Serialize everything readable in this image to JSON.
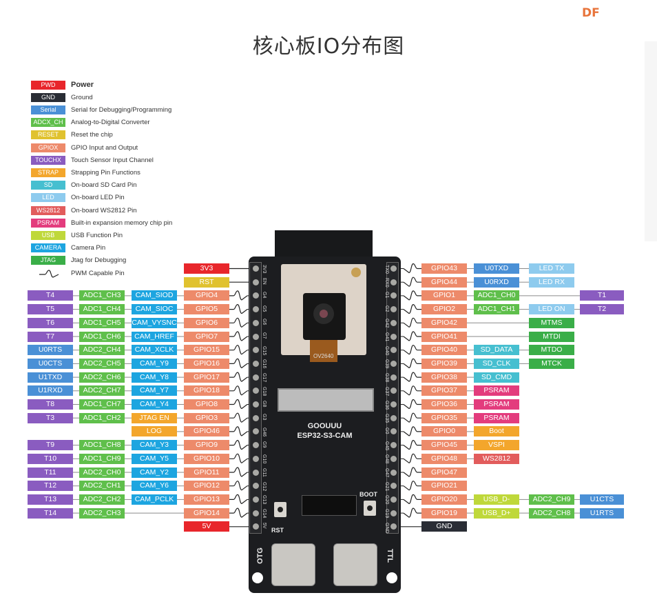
{
  "logo": "DF",
  "title": "核心板IO分布图",
  "colors": {
    "power": "#e8262b",
    "ground": "#2a2d35",
    "serial": "#4a90d6",
    "adc": "#5fbf4b",
    "reset": "#e0c22f",
    "gpio": "#ed8a6a",
    "touch": "#8a5cc0",
    "strap": "#f3a62c",
    "sd": "#46bfd0",
    "led": "#8ecbee",
    "ws2812": "#e25c5c",
    "psram": "#e33c7d",
    "usb": "#bfd83a",
    "camera": "#1da5e0",
    "jtag": "#3aae48",
    "line": "#8a8a8a"
  },
  "legend": [
    {
      "tag": "PWD",
      "type": "power",
      "desc": "Power"
    },
    {
      "tag": "GND",
      "type": "ground",
      "desc": "Ground"
    },
    {
      "tag": "Serial",
      "type": "serial",
      "desc": "Serial for Debugging/Programming"
    },
    {
      "tag": "ADCX_CH",
      "type": "adc",
      "desc": "Analog-to-Digital Converter"
    },
    {
      "tag": "RESET",
      "type": "reset",
      "desc": "Reset the chip"
    },
    {
      "tag": "GPIOX",
      "type": "gpio",
      "desc": "GPIO Input and Output"
    },
    {
      "tag": "TOUCHX",
      "type": "touch",
      "desc": "Touch Sensor Input Channel"
    },
    {
      "tag": "STRAP",
      "type": "strap",
      "desc": "Strapping Pin Functions"
    },
    {
      "tag": "SD",
      "type": "sd",
      "desc": "On-board SD Card Pin"
    },
    {
      "tag": "LED",
      "type": "led",
      "desc": "On-board LED Pin"
    },
    {
      "tag": "WS2812",
      "type": "ws2812",
      "desc": "On-board WS2812 Pin"
    },
    {
      "tag": "PSRAM",
      "type": "psram",
      "desc": "Built-in expansion memory chip pin"
    },
    {
      "tag": "USB",
      "type": "usb",
      "desc": "USB Function Pin"
    },
    {
      "tag": "CAMERA",
      "type": "camera",
      "desc": "Camera Pin"
    },
    {
      "tag": "JTAG",
      "type": "jtag",
      "desc": "Jtag for Debugging"
    },
    {
      "tag": "",
      "type": "pwm",
      "desc": "PWM Capable Pin"
    }
  ],
  "left_pins": [
    {
      "silk": "3V3",
      "pwm": false,
      "labels": [
        null,
        null,
        null,
        {
          "t": "3V3",
          "c": "power"
        }
      ]
    },
    {
      "silk": "EN",
      "pwm": false,
      "labels": [
        null,
        null,
        null,
        {
          "t": "RST",
          "c": "reset"
        }
      ]
    },
    {
      "silk": "G4",
      "pwm": true,
      "labels": [
        {
          "t": "T4",
          "c": "touch"
        },
        {
          "t": "ADC1_CH3",
          "c": "adc"
        },
        {
          "t": "CAM_SIOD",
          "c": "camera"
        },
        {
          "t": "GPIO4",
          "c": "gpio"
        }
      ]
    },
    {
      "silk": "G5",
      "pwm": true,
      "labels": [
        {
          "t": "T5",
          "c": "touch"
        },
        {
          "t": "ADC1_CH4",
          "c": "adc"
        },
        {
          "t": "CAM_SIOC",
          "c": "camera"
        },
        {
          "t": "GPIO5",
          "c": "gpio"
        }
      ]
    },
    {
      "silk": "G6",
      "pwm": true,
      "labels": [
        {
          "t": "T6",
          "c": "touch"
        },
        {
          "t": "ADC1_CH5",
          "c": "adc"
        },
        {
          "t": "CAM_VYSNC",
          "c": "camera"
        },
        {
          "t": "GPIO6",
          "c": "gpio"
        }
      ]
    },
    {
      "silk": "G7",
      "pwm": true,
      "labels": [
        {
          "t": "T7",
          "c": "touch"
        },
        {
          "t": "ADC1_CH6",
          "c": "adc"
        },
        {
          "t": "CAM_HREF",
          "c": "camera"
        },
        {
          "t": "GPIO7",
          "c": "gpio"
        }
      ]
    },
    {
      "silk": "G15",
      "pwm": true,
      "labels": [
        {
          "t": "U0RTS",
          "c": "serial"
        },
        {
          "t": "ADC2_CH4",
          "c": "adc"
        },
        {
          "t": "CAM_XCLK",
          "c": "camera"
        },
        {
          "t": "GPIO15",
          "c": "gpio"
        }
      ]
    },
    {
      "silk": "G16",
      "pwm": true,
      "labels": [
        {
          "t": "U0CTS",
          "c": "serial"
        },
        {
          "t": "ADC2_CH5",
          "c": "adc"
        },
        {
          "t": "CAM_Y9",
          "c": "camera"
        },
        {
          "t": "GPIO16",
          "c": "gpio"
        }
      ]
    },
    {
      "silk": "G17",
      "pwm": true,
      "labels": [
        {
          "t": "U1TXD",
          "c": "serial"
        },
        {
          "t": "ADC2_CH6",
          "c": "adc"
        },
        {
          "t": "CAM_Y8",
          "c": "camera"
        },
        {
          "t": "GPIO17",
          "c": "gpio"
        }
      ]
    },
    {
      "silk": "G18",
      "pwm": true,
      "labels": [
        {
          "t": "U1RXD",
          "c": "serial"
        },
        {
          "t": "ADC2_CH7",
          "c": "adc"
        },
        {
          "t": "CAM_Y7",
          "c": "camera"
        },
        {
          "t": "GPIO18",
          "c": "gpio"
        }
      ]
    },
    {
      "silk": "G8",
      "pwm": true,
      "labels": [
        {
          "t": "T8",
          "c": "touch"
        },
        {
          "t": "ADC1_CH7",
          "c": "adc"
        },
        {
          "t": "CAM_Y4",
          "c": "camera"
        },
        {
          "t": "GPIO8",
          "c": "gpio"
        }
      ]
    },
    {
      "silk": "G3",
      "pwm": true,
      "labels": [
        {
          "t": "T3",
          "c": "touch"
        },
        {
          "t": "ADC1_CH2",
          "c": "adc"
        },
        {
          "t": "JTAG EN",
          "c": "strap"
        },
        {
          "t": "GPIO3",
          "c": "gpio"
        }
      ]
    },
    {
      "silk": "G46",
      "pwm": true,
      "labels": [
        null,
        null,
        {
          "t": "LOG",
          "c": "strap"
        },
        {
          "t": "GPIO46",
          "c": "gpio"
        }
      ]
    },
    {
      "silk": "G9",
      "pwm": true,
      "labels": [
        {
          "t": "T9",
          "c": "touch"
        },
        {
          "t": "ADC1_CH8",
          "c": "adc"
        },
        {
          "t": "CAM_Y3",
          "c": "camera"
        },
        {
          "t": "GPIO9",
          "c": "gpio"
        }
      ]
    },
    {
      "silk": "G10",
      "pwm": true,
      "labels": [
        {
          "t": "T10",
          "c": "touch"
        },
        {
          "t": "ADC1_CH9",
          "c": "adc"
        },
        {
          "t": "CAM_Y5",
          "c": "camera"
        },
        {
          "t": "GPIO10",
          "c": "gpio"
        }
      ]
    },
    {
      "silk": "G11",
      "pwm": true,
      "labels": [
        {
          "t": "T11",
          "c": "touch"
        },
        {
          "t": "ADC2_CH0",
          "c": "adc"
        },
        {
          "t": "CAM_Y2",
          "c": "camera"
        },
        {
          "t": "GPIO11",
          "c": "gpio"
        }
      ]
    },
    {
      "silk": "G12",
      "pwm": true,
      "labels": [
        {
          "t": "T12",
          "c": "touch"
        },
        {
          "t": "ADC2_CH1",
          "c": "adc"
        },
        {
          "t": "CAM_Y6",
          "c": "camera"
        },
        {
          "t": "GPIO12",
          "c": "gpio"
        }
      ]
    },
    {
      "silk": "G13",
      "pwm": true,
      "labels": [
        {
          "t": "T13",
          "c": "touch"
        },
        {
          "t": "ADC2_CH2",
          "c": "adc"
        },
        {
          "t": "CAM_PCLK",
          "c": "camera"
        },
        {
          "t": "GPIO13",
          "c": "gpio"
        }
      ]
    },
    {
      "silk": "G14",
      "pwm": true,
      "labels": [
        {
          "t": "T14",
          "c": "touch"
        },
        {
          "t": "ADC2_CH3",
          "c": "adc"
        },
        null,
        {
          "t": "GPIO14",
          "c": "gpio"
        }
      ]
    },
    {
      "silk": "5V",
      "pwm": false,
      "labels": [
        null,
        null,
        null,
        {
          "t": "5V",
          "c": "power"
        }
      ]
    }
  ],
  "right_pins": [
    {
      "silk": "TX0",
      "pwm": true,
      "labels": [
        {
          "t": "GPIO43",
          "c": "gpio"
        },
        {
          "t": "U0TXD",
          "c": "serial"
        },
        {
          "t": "LED TX",
          "c": "led"
        },
        null
      ]
    },
    {
      "silk": "RX0",
      "pwm": true,
      "labels": [
        {
          "t": "GPIO44",
          "c": "gpio"
        },
        {
          "t": "U0RXD",
          "c": "serial"
        },
        {
          "t": "LED RX",
          "c": "led"
        },
        null
      ]
    },
    {
      "silk": "G1",
      "pwm": true,
      "labels": [
        {
          "t": "GPIO1",
          "c": "gpio"
        },
        {
          "t": "ADC1_CH0",
          "c": "adc"
        },
        null,
        {
          "t": "T1",
          "c": "touch"
        }
      ]
    },
    {
      "silk": "G2",
      "pwm": true,
      "labels": [
        {
          "t": "GPIO2",
          "c": "gpio"
        },
        {
          "t": "ADC1_CH1",
          "c": "adc"
        },
        {
          "t": "LED ON",
          "c": "led"
        },
        {
          "t": "T2",
          "c": "touch"
        }
      ]
    },
    {
      "silk": "G42",
      "pwm": true,
      "labels": [
        {
          "t": "GPIO42",
          "c": "gpio"
        },
        null,
        {
          "t": "MTMS",
          "c": "jtag"
        },
        null
      ]
    },
    {
      "silk": "G41",
      "pwm": true,
      "labels": [
        {
          "t": "GPIO41",
          "c": "gpio"
        },
        null,
        {
          "t": "MTDI",
          "c": "jtag"
        },
        null
      ]
    },
    {
      "silk": "G40",
      "pwm": true,
      "labels": [
        {
          "t": "GPIO40",
          "c": "gpio"
        },
        {
          "t": "SD_DATA",
          "c": "sd"
        },
        {
          "t": "MTDO",
          "c": "jtag"
        },
        null
      ]
    },
    {
      "silk": "G39",
      "pwm": true,
      "labels": [
        {
          "t": "GPIO39",
          "c": "gpio"
        },
        {
          "t": "SD_CLK",
          "c": "sd"
        },
        {
          "t": "MTCK",
          "c": "jtag"
        },
        null
      ]
    },
    {
      "silk": "G38",
      "pwm": true,
      "labels": [
        {
          "t": "GPIO38",
          "c": "gpio"
        },
        {
          "t": "SD_CMD",
          "c": "sd"
        },
        null,
        null
      ]
    },
    {
      "silk": "G37",
      "pwm": true,
      "labels": [
        {
          "t": "GPIO37",
          "c": "gpio"
        },
        {
          "t": "PSRAM",
          "c": "psram"
        },
        null,
        null
      ]
    },
    {
      "silk": "G36",
      "pwm": true,
      "labels": [
        {
          "t": "GPIO36",
          "c": "gpio"
        },
        {
          "t": "PSRAM",
          "c": "psram"
        },
        null,
        null
      ]
    },
    {
      "silk": "G35",
      "pwm": true,
      "labels": [
        {
          "t": "GPIO35",
          "c": "gpio"
        },
        {
          "t": "PSRAM",
          "c": "psram"
        },
        null,
        null
      ]
    },
    {
      "silk": "G0",
      "pwm": true,
      "labels": [
        {
          "t": "GPIO0",
          "c": "gpio"
        },
        {
          "t": "Boot",
          "c": "strap"
        },
        null,
        null
      ]
    },
    {
      "silk": "G45",
      "pwm": true,
      "labels": [
        {
          "t": "GPIO45",
          "c": "gpio"
        },
        {
          "t": "VSPI",
          "c": "strap"
        },
        null,
        null
      ]
    },
    {
      "silk": "G48",
      "pwm": true,
      "labels": [
        {
          "t": "GPIO48",
          "c": "gpio"
        },
        {
          "t": "WS2812",
          "c": "ws2812"
        },
        null,
        null
      ]
    },
    {
      "silk": "G47",
      "pwm": true,
      "labels": [
        {
          "t": "GPIO47",
          "c": "gpio"
        },
        null,
        null,
        null
      ]
    },
    {
      "silk": "G21",
      "pwm": true,
      "labels": [
        {
          "t": "GPIO21",
          "c": "gpio"
        },
        null,
        null,
        null
      ]
    },
    {
      "silk": "G20",
      "pwm": true,
      "labels": [
        {
          "t": "GPIO20",
          "c": "gpio"
        },
        {
          "t": "USB_D-",
          "c": "usb"
        },
        {
          "t": "ADC2_CH9",
          "c": "adc"
        },
        {
          "t": "U1CTS",
          "c": "serial"
        }
      ]
    },
    {
      "silk": "G19",
      "pwm": true,
      "labels": [
        {
          "t": "GPIO19",
          "c": "gpio"
        },
        {
          "t": "USB_D+",
          "c": "usb"
        },
        {
          "t": "ADC2_CH8",
          "c": "adc"
        },
        {
          "t": "U1RTS",
          "c": "serial"
        }
      ]
    },
    {
      "silk": "GND",
      "pwm": false,
      "labels": [
        {
          "t": "GND",
          "c": "ground"
        },
        null,
        null,
        null
      ]
    }
  ],
  "board": {
    "brand": "GOOUUU",
    "model": "ESP32-S3-CAM",
    "camera_label": "OV2640",
    "button_rst": "RST",
    "button_boot": "BOOT",
    "port_otg": "OTG",
    "port_ttl": "TTL"
  }
}
